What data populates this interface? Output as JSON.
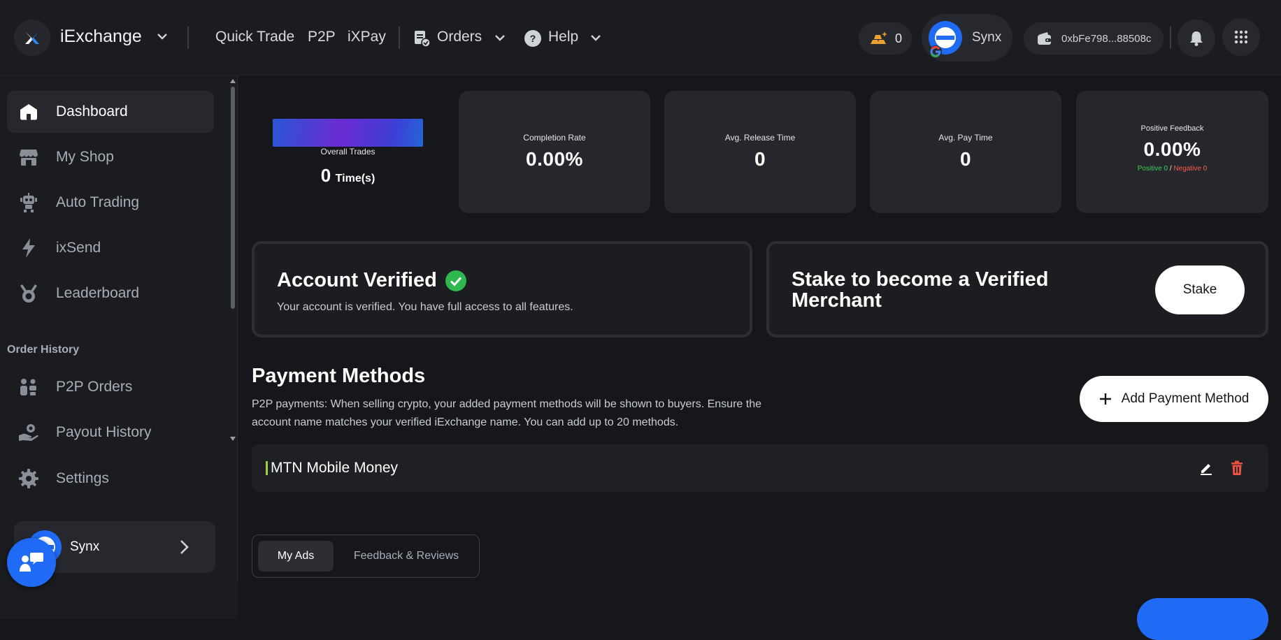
{
  "header": {
    "brand": "iExchange",
    "nav": [
      "Quick Trade",
      "P2P",
      "iXPay"
    ],
    "orders_label": "Orders",
    "help_label": "Help",
    "points_count": "0",
    "user_name": "Synx",
    "wallet_address": "0xbFe798...88508c"
  },
  "sidebar": {
    "items": [
      {
        "label": "Dashboard",
        "icon": "home-icon"
      },
      {
        "label": "My Shop",
        "icon": "shop-icon"
      },
      {
        "label": "Auto Trading",
        "icon": "robot-icon"
      },
      {
        "label": "ixSend",
        "icon": "lightning-icon"
      },
      {
        "label": "Leaderboard",
        "icon": "medal-icon"
      }
    ],
    "section_title": "Order History",
    "history_items": [
      {
        "label": "P2P Orders",
        "icon": "users-icon"
      },
      {
        "label": "Payout History",
        "icon": "hand-coin-icon"
      },
      {
        "label": "Settings",
        "icon": "gear-icon"
      }
    ],
    "user_name": "Synx"
  },
  "stats": {
    "overall_trades_label": "Overall Trades",
    "overall_trades_value": "0",
    "overall_trades_unit": "Time(s)",
    "completion_rate_label": "Completion Rate",
    "completion_rate_value": "0.00%",
    "avg_release_label": "Avg. Release Time",
    "avg_release_value": "0",
    "avg_pay_label": "Avg. Pay Time",
    "avg_pay_value": "0",
    "feedback_label": "Positive Feedback",
    "feedback_value": "0.00%",
    "feedback_positive": "Positive 0",
    "feedback_sep": "/",
    "feedback_negative": "Negative 0"
  },
  "verified": {
    "title": "Account Verified",
    "text": "Your account is verified. You have full access to all features."
  },
  "stake": {
    "title": "Stake to become a Verified Merchant",
    "button": "Stake"
  },
  "payment": {
    "title": "Payment Methods",
    "description_line1": "P2P payments: When selling crypto, your added payment methods will be shown to buyers. Ensure the",
    "description_line2": "account name matches your verified iExchange name. You can add up to 20 methods.",
    "add_button": "Add Payment Method",
    "methods": [
      {
        "name": "MTN Mobile Money"
      }
    ]
  },
  "tabs": [
    "My Ads",
    "Feedback & Reviews"
  ],
  "colors": {
    "accent_blue": "#1f6bf5",
    "positive": "#3ecf5a",
    "negative": "#ff5a4a",
    "delete": "#e8523f",
    "method_bar": "#9bd43a",
    "points": "#f0a030"
  }
}
